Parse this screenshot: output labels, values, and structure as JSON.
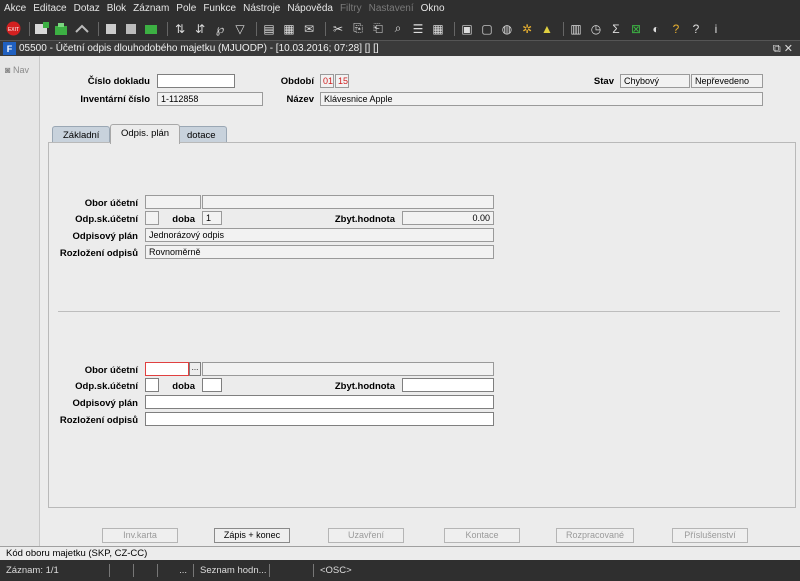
{
  "menu": [
    "Akce",
    "Editace",
    "Dotaz",
    "Blok",
    "Záznam",
    "Pole",
    "Funkce",
    "Nástroje",
    "Nápověda",
    "Filtry",
    "Nastavení",
    "Okno"
  ],
  "menu_disabled": [
    "Filtry",
    "Nastavení"
  ],
  "toolbar_icons": [
    "exit-icon",
    "new-record-icon",
    "insert-icon",
    "save-icon",
    "find-icon",
    "query-icon",
    "execute-query-icon",
    "sort-asc-icon",
    "sort-desc-icon",
    "filter-icon",
    "funnel-icon",
    "print-icon",
    "print-preview-icon",
    "email-icon",
    "cut-icon",
    "copy-icon",
    "paste-icon",
    "attach-icon",
    "list-icon",
    "grid-icon",
    "export-icon",
    "document-icon",
    "globe-icon",
    "settings-icon",
    "warning-icon",
    "calendar-icon",
    "clock-icon",
    "sum-icon",
    "excel-icon",
    "chart-icon",
    "user-help-icon",
    "help-icon",
    "info-icon"
  ],
  "title": "05500 - Účetní odpis dlouhodobého majetku (MJUODP) - [10.03.2016; 07:28] [] []",
  "nav_label": "Nav",
  "header": {
    "cislo_dokladu_label": "Číslo dokladu",
    "cislo_dokladu_value": "",
    "inventarni_cislo_label": "Inventární číslo",
    "inventarni_cislo_value": "1-112858",
    "obdobi_label": "Období",
    "obdobi_month": "01",
    "obdobi_year": "15",
    "nazev_label": "Název",
    "nazev_value": "Klávesnice Apple",
    "stav_label": "Stav",
    "stav_value1": "Chybový",
    "stav_value2": "Nepřevedeno"
  },
  "tabs": [
    "Základní",
    "Odpis. plán",
    "dotace"
  ],
  "active_tab": "Odpis. plán",
  "upper": {
    "obor_ucetni_label": "Obor účetní",
    "obor_ucetni_code": "",
    "obor_ucetni_name": "",
    "odp_sk_label": "Odp.sk.účetní",
    "odp_sk_value": "",
    "doba_label": "doba",
    "doba_value": "1",
    "zbyt_label": "Zbyt.hodnota",
    "zbyt_value": "0.00",
    "plan_label": "Odpisový plán",
    "plan_value": "Jednorázový odpis",
    "rozlozeni_label": "Rozložení odpisů",
    "rozlozeni_value": "Rovnoměrně"
  },
  "lower": {
    "obor_ucetni_label": "Obor účetní",
    "lov_label": "...",
    "odp_sk_label": "Odp.sk.účetní",
    "doba_label": "doba",
    "zbyt_label": "Zbyt.hodnota",
    "plan_label": "Odpisový plán",
    "rozlozeni_label": "Rozložení odpisů"
  },
  "buttons": [
    "Inv.karta",
    "Zápis + konec",
    "Uzavření",
    "Kontace",
    "Rozpracované",
    "Příslušenství"
  ],
  "hint": "Kód oboru majetku (SKP, CZ-CC)",
  "status": {
    "record": "Záznam: 1/1",
    "c2": "",
    "c3": "",
    "c4": "...",
    "list": "Seznam hodn...",
    "c6": "",
    "osc": "<OSC>"
  }
}
